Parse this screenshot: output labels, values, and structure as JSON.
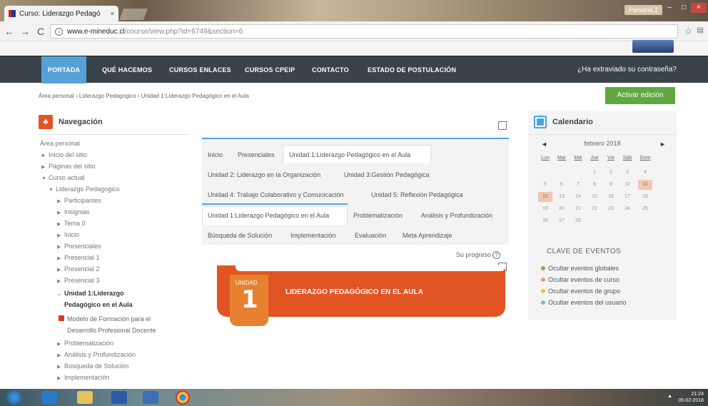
{
  "browser": {
    "tab_title": "Curso: Liderazgo Pedagó",
    "tab_close": "×",
    "profile": "Persona 2",
    "url_host": "www.e-mineduc.cl",
    "url_path": "/course/view.php?id=6749&section=6",
    "back": "←",
    "forward": "→",
    "reload": "C",
    "star": "☆",
    "win_min": "–",
    "win_max": "□",
    "win_close": "×"
  },
  "nav": {
    "items": [
      "PORTADA",
      "QUÉ HACEMOS",
      "CURSOS ENLACES",
      "CURSOS CPEIP",
      "CONTACTO",
      "ESTADO DE POSTULACIÓN"
    ],
    "forgot": "¿Ha extraviado su contraseña?"
  },
  "breadcrumb": "Área personal  ›  Liderazgo Pedagogico  ›  Unidad 1:Liderazgo Pedagógico en el Aula",
  "edit_button": "Activar edición",
  "navigation": {
    "title": "Navegación",
    "items": [
      "Área personal",
      "Inicio del sitio",
      "Páginas del sitio",
      "Curso actual",
      "Liderazgo Pedagogico",
      "Participantes",
      "Insignias",
      "Tema 0",
      "Inicio",
      "Presenciales",
      "Presencial 1",
      "Presencial 2",
      "Presencial 3",
      "Unidad 1:Liderazgo",
      "Pedagógico en el Aula",
      "Modelo de Formación para el",
      "Desarrollo Profesional Docente",
      "Problematización",
      "Análisis y Profundización",
      "Búsqueda de Solución",
      "Implementación"
    ]
  },
  "course_tabs": {
    "row1": [
      "Inicio",
      "Presenciales",
      "Unidad 1:Liderazgo Pedagógico en el Aula"
    ],
    "row2": [
      "Unidad 2: Liderazgo en la Organización",
      "Unidad 3:Gestión Pedagógica"
    ],
    "row3": [
      "Unidad 4: Trabajo Colaborativo y Comunicación",
      "Unidad 5: Reflexión Pedagógica"
    ],
    "row4": [
      "Unidad 1:Liderazgo Pedagógico en el Aula",
      "Problematización",
      "Análisis y Profundización"
    ],
    "row5": [
      "Búsqueda de Solución",
      "Implementación",
      "Evaluación",
      "Meta Aprendizaje"
    ]
  },
  "progress_label": "Su progreso",
  "progress_help": "?",
  "unit_banner": {
    "label": "UNIDAD",
    "number": "1",
    "title": "LIDERAZGO PEDAGÓGICO EN EL AULA"
  },
  "calendar": {
    "title": "Calendario",
    "month": "febrero 2018",
    "prev": "◄",
    "next": "►",
    "dow": [
      "Lun",
      "Mar",
      "Mié",
      "Jue",
      "Vie",
      "Sáb",
      "Dom"
    ],
    "weeks": [
      [
        "",
        "",
        "",
        "1",
        "2",
        "3",
        "4"
      ],
      [
        "5",
        "6",
        "7",
        "8",
        "9",
        "10",
        "11"
      ],
      [
        "12",
        "13",
        "14",
        "15",
        "16",
        "17",
        "18"
      ],
      [
        "19",
        "20",
        "21",
        "22",
        "23",
        "24",
        "25"
      ],
      [
        "26",
        "27",
        "28",
        "",
        "",
        "",
        ""
      ]
    ],
    "highlighted": [
      "11",
      "12"
    ],
    "key_title": "CLAVE DE EVENTOS",
    "events": [
      {
        "label": "Ocultar eventos globales",
        "color": "#7ab648"
      },
      {
        "label": "Ocultar eventos de curso",
        "color": "#f0a060"
      },
      {
        "label": "Ocultar eventos de grupo",
        "color": "#f2c230"
      },
      {
        "label": "Ocultar eventos del usuario",
        "color": "#8fb0d0"
      }
    ]
  },
  "taskbar": {
    "time": "21:24",
    "date": "05-02-2018"
  }
}
